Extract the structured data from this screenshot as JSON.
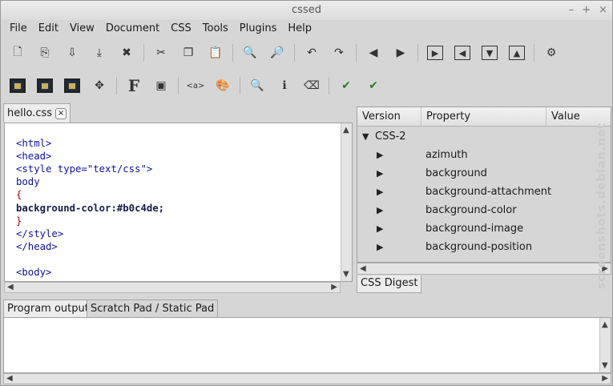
{
  "window": {
    "title": "cssed"
  },
  "menu": [
    "File",
    "Edit",
    "View",
    "Document",
    "CSS",
    "Tools",
    "Plugins",
    "Help"
  ],
  "editor": {
    "tab_label": "hello.css",
    "lines": [
      "<html>",
      "<head>",
      "<style type=\"text/css\">",
      "body",
      "{",
      "background-color:#b0c4de;",
      "}",
      "</style>",
      "</head>",
      "",
      "<body>"
    ]
  },
  "css_tree": {
    "columns": [
      "Version",
      "Property",
      "Value"
    ],
    "group": "CSS-2",
    "properties": [
      "azimuth",
      "background",
      "background-attachment",
      "background-color",
      "background-image",
      "background-position"
    ]
  },
  "digest_tab": "CSS Digest",
  "bottom_tabs": [
    "Program output",
    "Scratch Pad / Static Pad"
  ],
  "watermark": "screenshots.debian.net"
}
